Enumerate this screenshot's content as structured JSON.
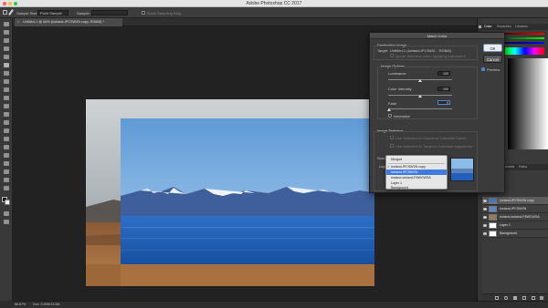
{
  "app": {
    "window_title": "Adobe Photoshop CC 2017"
  },
  "options_bar": {
    "sample_size_label": "Sample Size:",
    "sample_size_value": "Point Sample",
    "sample_label": "Sample:",
    "show_ring_label": "Show Sampling Ring"
  },
  "document": {
    "tab_title": "Untitled-1 @ 66% (Iceland-IPCSW2N copy, RGB/8) *"
  },
  "status_bar": {
    "zoom": "66.67%",
    "doc_size": "Doc: 3.00M/13.5M"
  },
  "panels": {
    "top_tabs": [
      "Color",
      "Swatches",
      "Libraries"
    ],
    "layer_tabs": [
      "Layers",
      "Channels",
      "Paths"
    ],
    "layers": [
      {
        "name": "Iceland-IPCSW2N copy",
        "selected": true
      },
      {
        "name": "Iceland-IPCSW2N",
        "selected": false
      },
      {
        "name": "iceland-iceland-P8WCWSA",
        "selected": false
      },
      {
        "name": "Layer 1",
        "selected": false
      },
      {
        "name": "Background",
        "selected": false
      }
    ]
  },
  "match_color": {
    "title": "Match Color",
    "destination_header": "Destination Image",
    "target_label": "Target:",
    "target_value": "Untitled-1 (Iceland-IPCSW2... RGB/8)",
    "ignore_selection_label": "Ignore Selection when Applying Adjustment",
    "image_options_header": "Image Options",
    "luminance_label": "Luminance",
    "luminance_value": "100",
    "color_intensity_label": "Color Intensity",
    "color_intensity_value": "100",
    "fade_label": "Fade",
    "fade_value": "0",
    "neutralize_label": "Neutralize",
    "image_statistics_header": "Image Statistics",
    "use_source_selection_label": "Use Selection in Source to Calculate Colors",
    "use_target_selection_label": "Use Selection in Target to Calculate Adjustment",
    "source_label": "Source",
    "layer_label": "Layer",
    "ok_label": "OK",
    "cancel_label": "Cancel",
    "preview_label": "Preview",
    "preview_checked": true,
    "dropdown_items": [
      "Merged",
      "Iceland-IPCSW2N copy",
      "Iceland-IPCSW2N",
      "iceland-iceland-P8WCWSA",
      "Layer 1",
      "Background"
    ],
    "dropdown_selected_index": 2,
    "dropdown_checked_index": 1
  },
  "colors": {
    "accent": "#3f7be0",
    "sky": "#7fb2e0",
    "sea": "#1f5cb8"
  }
}
